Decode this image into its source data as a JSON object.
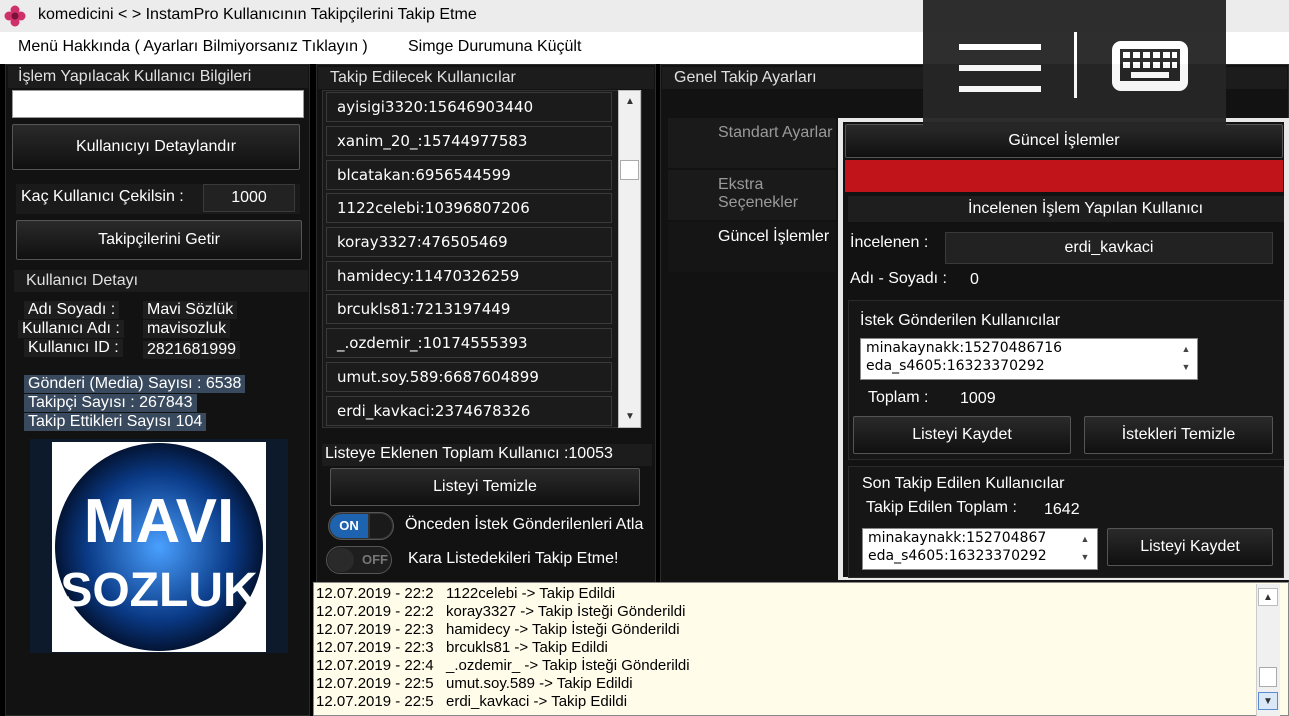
{
  "window": {
    "title": "komedicini < > InstamPro  Kullanıcının Takipçilerini Takip Etme"
  },
  "menu": [
    {
      "label": "Menü Hakkında ( Ayarları Bilmiyorsanız Tıklayın )"
    },
    {
      "label": "Simge Durumuna Küçült"
    }
  ],
  "overlay": {
    "icons": [
      "hamburger-menu-icon",
      "keyboard-icon"
    ]
  },
  "left": {
    "header": "İşlem Yapılacak Kullanıcı Bilgileri",
    "username_input": "",
    "detail_button": "Kullanıcıyı Detaylandır",
    "count_label": "Kaç Kullanıcı Çekilsin :",
    "count_value": "1000",
    "fetch_button": "Takipçilerini Getir",
    "detail_header": "Kullanıcı Detayı",
    "name_label": "Adı Soyadı :",
    "name_value": "Mavi Sözlük",
    "username_label": "Kullanıcı Adı :",
    "username_value": "mavisozluk",
    "id_label": "Kullanıcı ID :",
    "id_value": "2821681999",
    "posts": "Gönderi (Media) Sayısı : 6538",
    "followers": "Takipçi Sayısı : 267843",
    "following": "Takip Ettikleri Sayısı  104",
    "logo_line1": "MAVI",
    "logo_line2": "SOZLUK"
  },
  "middle": {
    "header": "Takip Edilecek Kullanıcılar",
    "users": [
      "ayisigi3320:15646903440",
      "xanim_20_:15744977583",
      "blcatakan:6956544599",
      "1122celebi:10396807206",
      "koray3327:476505469",
      "hamidecy:11470326259",
      "brcukls81:7213197449",
      "_.ozdemir_:10174555393",
      "umut.soy.589:6687604899",
      "erdi_kavkaci:2374678326"
    ],
    "total_label": "Listeye Eklenen Toplam Kullanıcı :10053",
    "clear_button": "Listeyi Temizle",
    "toggle1_state": "ON",
    "toggle1_label": "Önceden İstek Gönderilenleri Atla",
    "toggle2_state": "OFF",
    "toggle2_label": "Kara Listedekileri Takip Etme!"
  },
  "right": {
    "header": "Genel Takip Ayarları",
    "tabs": [
      {
        "label": "Standart Ayarlar"
      },
      {
        "label": "Ekstra Seçenekler"
      },
      {
        "label": "Güncel İşlemler"
      }
    ],
    "current_ops_title": "Güncel İşlemler",
    "progress": 1.0,
    "progress_color": "#c0141a",
    "inspected_header": "İncelenen İşlem Yapılan Kullanıcı",
    "inspected_label": "İncelenen :",
    "inspected_value": "erdi_kavkaci",
    "fullname_label": "Adı - Soyadı :",
    "fullname_value": "0",
    "requests_header": "İstek Gönderilen Kullanıcılar",
    "requests": [
      "minakaynakk:15270486716",
      "eda_s4605:16323370292"
    ],
    "requests_total_label": "Toplam :",
    "requests_total_value": "1009",
    "save_list_button": "Listeyi Kaydet",
    "clear_requests_button": "İstekleri Temizle",
    "last_followed_header": "Son Takip Edilen Kullanıcılar",
    "followed_total_label": "Takip Edilen Toplam :",
    "followed_total_value": "1642",
    "followed": [
      "minakaynakk:152704867",
      "eda_s4605:16323370292"
    ],
    "save_list_button2": "Listeyi Kaydet"
  },
  "log": [
    {
      "time": "12.07.2019 - 22:2",
      "text": "1122celebi -> Takip Edildi"
    },
    {
      "time": "12.07.2019 - 22:2",
      "text": "koray3327 -> Takip İsteği Gönderildi"
    },
    {
      "time": "12.07.2019 - 22:3",
      "text": "hamidecy -> Takip İsteği Gönderildi"
    },
    {
      "time": "12.07.2019 - 22:3",
      "text": "brcukls81 -> Takip Edildi"
    },
    {
      "time": "12.07.2019 - 22:4",
      "text": "_.ozdemir_ -> Takip İsteği Gönderildi"
    },
    {
      "time": "12.07.2019 - 22:5",
      "text": "umut.soy.589 -> Takip Edildi"
    },
    {
      "time": "12.07.2019 - 22:5",
      "text": "erdi_kavkaci -> Takip Edildi"
    }
  ]
}
